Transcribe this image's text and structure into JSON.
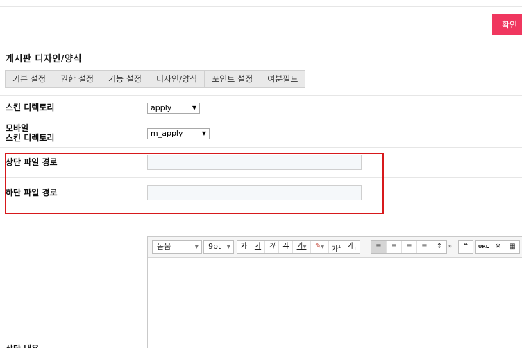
{
  "header": {
    "confirm_label": "확인"
  },
  "section": {
    "title": "게시판 디자인/양식"
  },
  "tabs": [
    {
      "label": "기본 설정"
    },
    {
      "label": "권한 설정"
    },
    {
      "label": "기능 설정"
    },
    {
      "label": "디자인/양식"
    },
    {
      "label": "포인트 설정"
    },
    {
      "label": "여분필드"
    }
  ],
  "fields": {
    "skin_dir": {
      "label": "스킨 디렉토리",
      "value": "apply"
    },
    "mobile_skin_dir": {
      "label_line1": "모바일",
      "label_line2": "스킨 디렉토리",
      "value": "m_apply"
    },
    "top_file_path": {
      "label": "상단 파일 경로",
      "value": ""
    },
    "bottom_file_path": {
      "label": "하단 파일 경로",
      "value": ""
    },
    "top_content": {
      "label": "상단 내용"
    }
  },
  "editor": {
    "font_family": "돋움",
    "font_size": "9pt",
    "style_buttons": [
      "가",
      "가",
      "가",
      "가",
      "가"
    ],
    "script_buttons": [
      "가",
      "가"
    ],
    "quote_symbol": "❝",
    "url_label": "URL",
    "special_char": "※"
  },
  "colors": {
    "confirm_button": "#f0375f",
    "highlight_border": "#d7191c"
  }
}
